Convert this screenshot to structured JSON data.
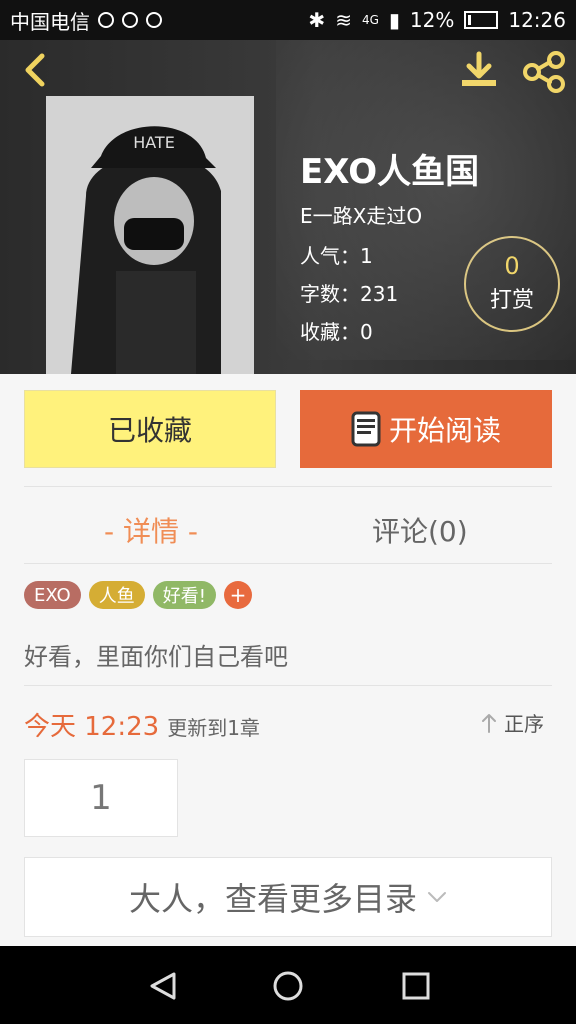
{
  "status": {
    "carrier": "中国电信",
    "signal_text": "4G",
    "battery_percent": "12%",
    "battery_fraction": 0.12,
    "time": "12:26"
  },
  "header": {
    "back_icon": "back-arrow-icon",
    "download_icon": "download-icon",
    "share_icon": "share-icon",
    "cover_text": "HATE",
    "title": "EXO人鱼国",
    "author": "E一路X走过O",
    "popularity": "人气：1",
    "word_count": "字数：231",
    "favorites": "收藏：0",
    "tip_count": "0",
    "tip_label": "打赏",
    "accent": "#f0d35f"
  },
  "actions": {
    "collected_label": "已收藏",
    "read_label": "开始阅读",
    "read_color": "#e66a3b",
    "collected_color": "#fff27c"
  },
  "tabs": {
    "detail": "- 详情 -",
    "comment": "评论(0)"
  },
  "tags": [
    "EXO",
    "人鱼",
    "好看!",
    "+"
  ],
  "description": "好看，里面你们自己看吧",
  "update": {
    "date": "今天 12:23",
    "text": "更新到1章",
    "sort_label": "正序"
  },
  "chapters": {
    "first": "1",
    "more_label": "大人，查看更多目录"
  }
}
